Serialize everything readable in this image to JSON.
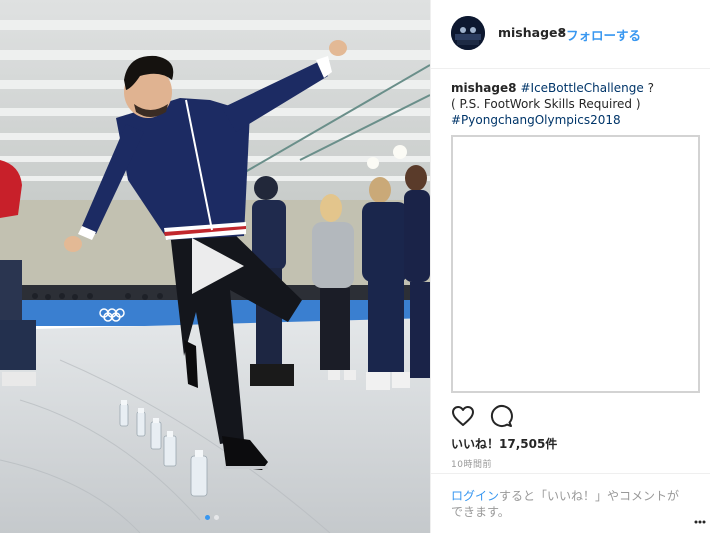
{
  "post": {
    "username": "mishage8",
    "separator": "•",
    "follow_label": "フォローする",
    "caption": {
      "username": "mishage8",
      "hashtag1": "#IceBottleChallenge",
      "suffix1": " ?",
      "line2": "( P.S. FootWork Skills Required )",
      "hashtag2": "#PyongchangOlympics2018"
    },
    "actions": [
      "heart-icon",
      "comment-icon"
    ],
    "likes_text": "いいね！17,505件",
    "timestamp": "10時間前",
    "login_link": "ログイン",
    "login_text": "すると「いいね！」やコメントができます。",
    "more_icon": "more-options-icon"
  },
  "media": {
    "type": "video",
    "play_icon": "play-icon",
    "carousel_dots": 2,
    "active_dot": 0
  },
  "colors": {
    "link_blue": "#3897f0",
    "hashtag_blue": "#003569",
    "text": "#262626",
    "muted": "#999999"
  }
}
